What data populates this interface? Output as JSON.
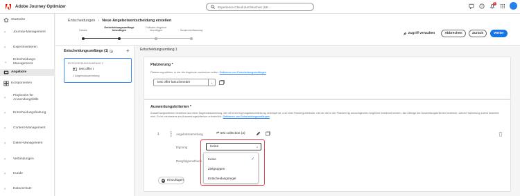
{
  "app": {
    "title": "Adobe Journey Optimizer"
  },
  "search": {
    "placeholder": "Experience Cloud durchsuchen (Str..."
  },
  "header": {
    "notification_count": "2"
  },
  "sidebar": {
    "items": [
      {
        "label": "Startseite",
        "icon": "home-icon"
      },
      {
        "label": "Journey-Management",
        "icon": "chevron-right-icon"
      },
      {
        "label": "Experimentieren",
        "icon": "chevron-right-icon"
      },
      {
        "label": "Entscheidungs-Management",
        "icon": "chevron-down-icon"
      },
      {
        "label": "Angebote",
        "icon": "offers-icon"
      },
      {
        "label": "Komponenten",
        "icon": "components-icon"
      },
      {
        "label": "Playbooks für Anwendungsfälle",
        "icon": "chevron-right-icon"
      },
      {
        "label": "Entscheidungsfindung",
        "icon": "chevron-right-icon"
      },
      {
        "label": "Content-Management",
        "icon": "chevron-right-icon"
      },
      {
        "label": "Daten-Management",
        "icon": "chevron-right-icon"
      },
      {
        "label": "Verbindungen",
        "icon": "chevron-right-icon"
      },
      {
        "label": "Kunde",
        "icon": "chevron-right-icon"
      },
      {
        "label": "Datenschutz",
        "icon": "chevron-right-icon"
      }
    ]
  },
  "breadcrumb": {
    "parent": "Entscheidungen",
    "separator": "›",
    "current": "Neue Angebotsentscheidung erstellen"
  },
  "steps": [
    {
      "label": "Details"
    },
    {
      "label": "Entscheidungsumfänge hinzufügen"
    },
    {
      "label": "Fallback-Angebot hinzufügen"
    },
    {
      "label": "Zusammenfassung"
    }
  ],
  "actions": {
    "manage_access": "Zugriff verwalten",
    "cancel": "Abbrechen",
    "back": "Zurück",
    "next": "Weiter"
  },
  "left_panel": {
    "title": "Entscheidungsumfänge (1)",
    "card_caption": "ENTSCHEIDUNGSUMFANG 1",
    "card_name": "test offer I",
    "card_sub": "1 Angebotssammlung"
  },
  "content": {
    "title": "Entscheidungsumfang 1",
    "placement": {
      "heading": "Platzierung",
      "required_mark": "*",
      "description": "Platzierung wählen, in der die Angebote erscheinen sollen.",
      "link": "Definieren von Entscheidungsumfängen",
      "selected": "test offer lanuchmedm"
    },
    "evaluation": {
      "heading": "Auswertungskriterien",
      "required_mark": "*",
      "description": "Auswertungskriterien bestehen aus einer Angebotssammlung, die mit einer Eignungsbeschränkung verknüpft ist, und einer Ranking-Methode, mit der die in der Platzierung anzuzeigenden Angebote bestimmt werden. Die Abfolge der Auswertungskriterien bestimmt, welche Sammlung zuerst bewertet wird. Es ist mindestens ein Auswertungskriterium erforderlich.",
      "link": "Definieren von Entscheidungsumfängen",
      "row_number": "1",
      "collection_label": "Angebotssammlung",
      "collection_value": "test collection (2)",
      "eligibility_label": "Eignung",
      "eligibility_selected": "Keine",
      "ranking_label": "Rangfolgemethode",
      "dropdown_options": [
        {
          "label": "Keine",
          "checked": true
        },
        {
          "label": "Zielgruppen",
          "checked": false
        },
        {
          "label": "Entscheidungsregel",
          "checked": false
        }
      ],
      "add_label": "Hinzufügen"
    }
  },
  "colors": {
    "accent": "#1473e6",
    "highlight": "#e34850"
  }
}
